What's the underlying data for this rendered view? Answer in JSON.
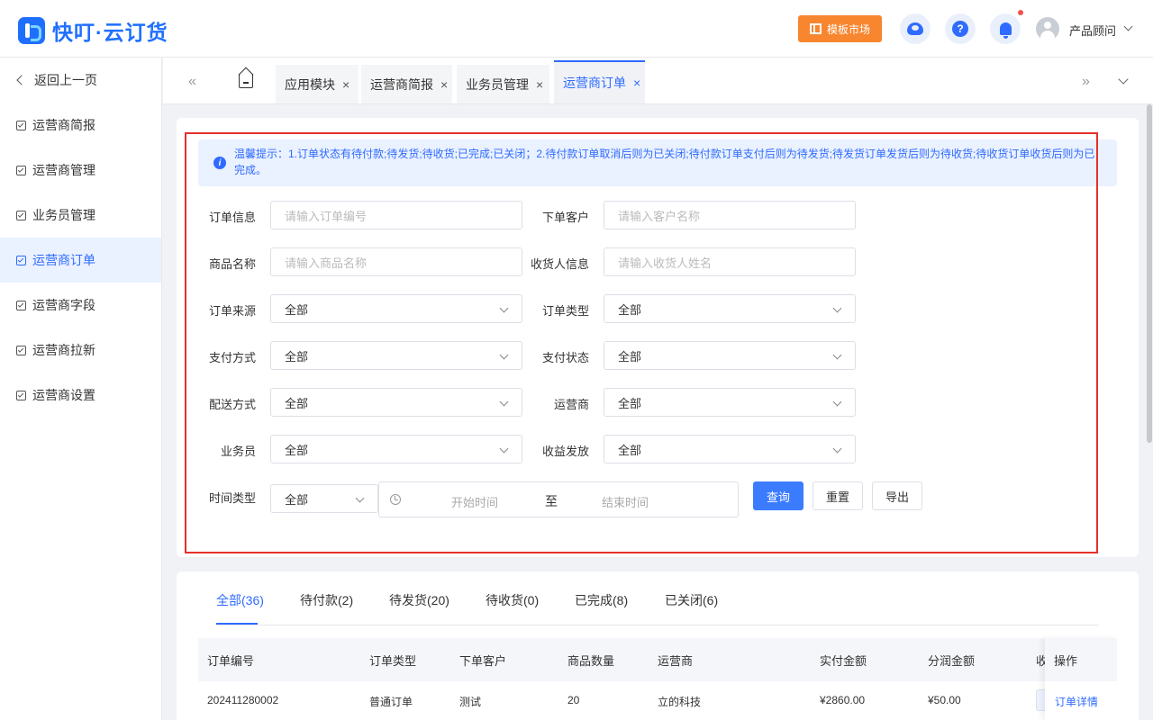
{
  "header": {
    "logo_text": "快叮·云订货",
    "template_market": "模板市场",
    "help_glyph": "?",
    "user_name": "产品顾问"
  },
  "sidebar": {
    "back": "返回上一页",
    "items": [
      {
        "label": "运营商简报"
      },
      {
        "label": "运营商管理"
      },
      {
        "label": "业务员管理"
      },
      {
        "label": "运营商订单"
      },
      {
        "label": "运营商字段"
      },
      {
        "label": "运营商拉新"
      },
      {
        "label": "运营商设置"
      }
    ]
  },
  "tabs": {
    "prev": "«",
    "next": "»",
    "close_glyph": "×",
    "items": [
      {
        "label": "应用模块"
      },
      {
        "label": "运营商简报"
      },
      {
        "label": "业务员管理"
      },
      {
        "label": "运营商订单"
      }
    ]
  },
  "tip": {
    "icon": "i",
    "text": "温馨提示：1.订单状态有待付款;待发货;待收货;已完成;已关闭；2.待付款订单取消后则为已关闭;待付款订单支付后则为待发货;待发货订单发货后则为待收货;待收货订单收货后则为已完成。"
  },
  "filters": {
    "order_info": {
      "label": "订单信息",
      "placeholder": "请输入订单编号"
    },
    "customer": {
      "label": "下单客户",
      "placeholder": "请输入客户名称"
    },
    "product_name": {
      "label": "商品名称",
      "placeholder": "请输入商品名称"
    },
    "receiver": {
      "label": "收货人信息",
      "placeholder": "请输入收货人姓名"
    },
    "order_source": {
      "label": "订单来源",
      "value": "全部"
    },
    "order_type": {
      "label": "订单类型",
      "value": "全部"
    },
    "pay_method": {
      "label": "支付方式",
      "value": "全部"
    },
    "pay_status": {
      "label": "支付状态",
      "value": "全部"
    },
    "delivery": {
      "label": "配送方式",
      "value": "全部"
    },
    "operator": {
      "label": "运营商",
      "value": "全部"
    },
    "salesman": {
      "label": "业务员",
      "value": "全部"
    },
    "revenue": {
      "label": "收益发放",
      "value": "全部"
    },
    "time_type": {
      "label": "时间类型",
      "value": "全部"
    },
    "start_time": "开始时间",
    "range_sep": "至",
    "end_time": "结束时间",
    "query": "查询",
    "reset": "重置",
    "export": "导出"
  },
  "status_tabs": [
    "全部(36)",
    "待付款(2)",
    "待发货(20)",
    "待收货(0)",
    "已完成(8)",
    "已关闭(6)"
  ],
  "table": {
    "columns": [
      "订单编号",
      "订单类型",
      "下单客户",
      "商品数量",
      "运营商",
      "实付金额",
      "分润金额",
      "收",
      "操作"
    ],
    "rows": [
      {
        "order_no": "202411280002",
        "type": "普通订单",
        "customer": "测试",
        "qty": "20",
        "operator": "立的科技",
        "paid": "¥2860.00",
        "share": "¥50.00",
        "action": "订单详情"
      }
    ]
  },
  "colors": {
    "primary": "#2f6bff",
    "orange": "#f7862f",
    "highlight_border": "#e5302b"
  }
}
